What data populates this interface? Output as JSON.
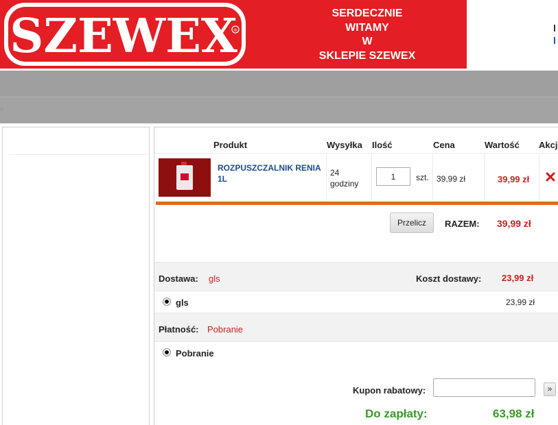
{
  "header": {
    "logo_text": "SZEWEX",
    "welcome_lines": [
      "SERDECZNIE",
      "WITAMY",
      "W",
      "SKLEPIE SZEWEX"
    ],
    "brand_red": "#e31e24"
  },
  "cart": {
    "columns": {
      "product": "Produkt",
      "shipping": "Wysyłka",
      "quantity": "Ilość",
      "price": "Cena",
      "value": "Wartość",
      "action": "Akcje"
    },
    "items": [
      {
        "name": "ROZPUSZCZALNIK RENIA 1L",
        "shipping_lines": [
          "24",
          "godziny"
        ],
        "quantity": "1",
        "unit": "szt.",
        "price": "39,99 zł",
        "value": "39,99 zł",
        "remove_icon": "close-icon"
      }
    ],
    "recalc_label": "Przelicz",
    "total_label": "RAZEM:",
    "total_value": "39,99 zł"
  },
  "delivery": {
    "label": "Dostawa:",
    "selected": "gls",
    "cost_label": "Koszt dostawy:",
    "cost_value": "23,99 zł",
    "options": [
      {
        "label": "gls",
        "price": "23,99 zł"
      }
    ]
  },
  "payment": {
    "label": "Płatność:",
    "selected": "Pobranie",
    "options": [
      {
        "label": "Pobranie"
      }
    ]
  },
  "coupon": {
    "label": "Kupon rabatowy:",
    "value": "",
    "submit_label": "»"
  },
  "summary": {
    "label": "Do zapłaty:",
    "value": "63,98 zł"
  },
  "colors": {
    "accent_red": "#cc1f1f",
    "link_blue": "#1a4b8c",
    "total_green": "#3a9a2a",
    "divider_orange": "#e26b1c",
    "nav_gray": "#a3a3a3"
  }
}
